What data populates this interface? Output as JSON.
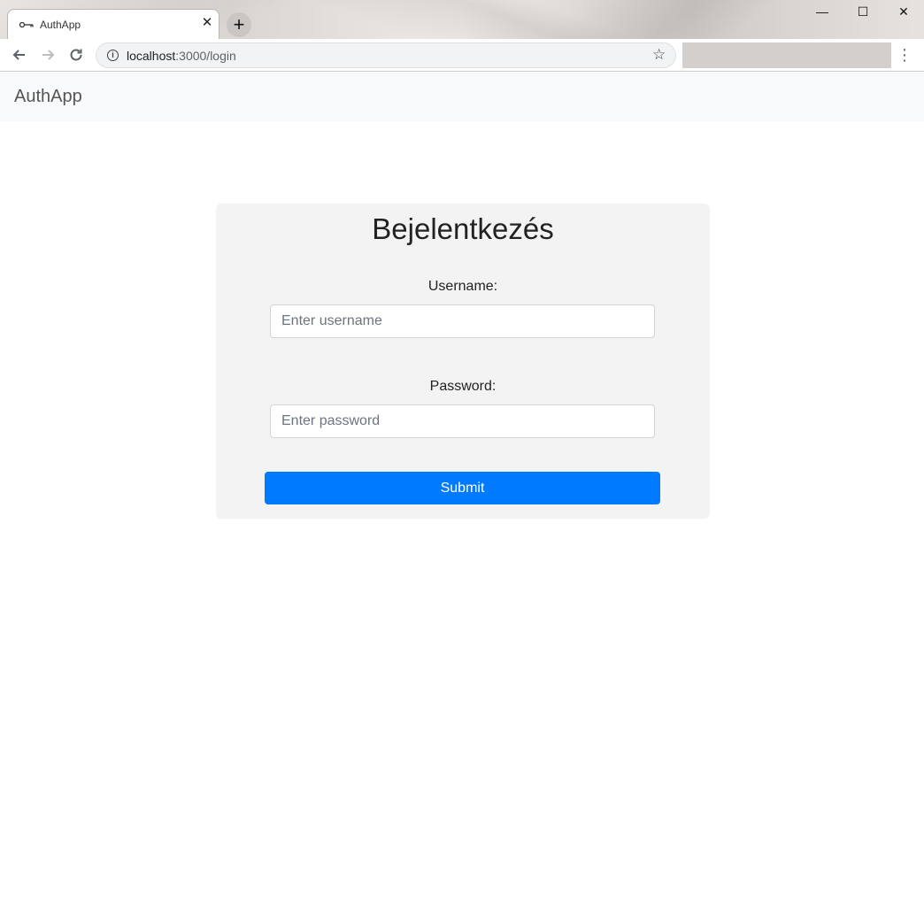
{
  "browser": {
    "tab_title": "AuthApp",
    "tab_close": "✕",
    "new_tab": "+",
    "url_host": "localhost",
    "url_path": ":3000/login",
    "window_controls": {
      "minimize": "—",
      "maximize": "☐",
      "close": "✕"
    }
  },
  "navbar": {
    "brand": "AuthApp"
  },
  "login": {
    "title": "Bejelentkezés",
    "username_label": "Username:",
    "username_placeholder": "Enter username",
    "username_value": "",
    "password_label": "Password:",
    "password_placeholder": "Enter password",
    "password_value": "",
    "submit_label": "Submit"
  },
  "colors": {
    "primary": "#007bff",
    "navbar_bg": "#f8f9fa",
    "card_bg": "#f3f3f3"
  }
}
